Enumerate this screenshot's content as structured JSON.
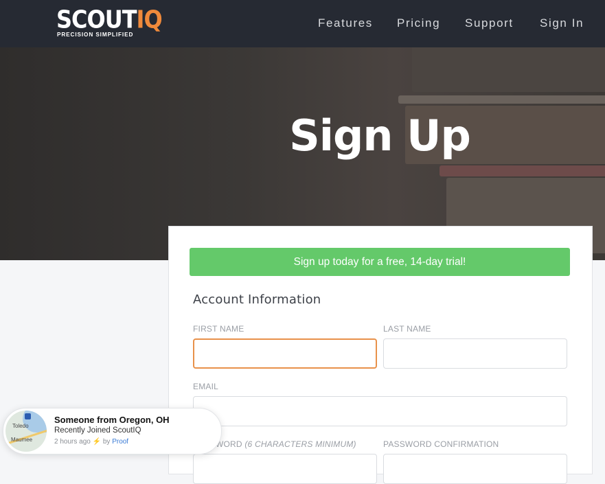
{
  "header": {
    "logo_main": "SCOUT",
    "logo_accent": "IQ",
    "logo_tagline": "PRECISION SIMPLIFIED",
    "nav": [
      {
        "label": "Features"
      },
      {
        "label": "Pricing"
      },
      {
        "label": "Support"
      },
      {
        "label": "Sign In"
      }
    ]
  },
  "hero": {
    "title": "Sign Up"
  },
  "form": {
    "banner": "Sign up today for a free, 14-day trial!",
    "section_title": "Account Information",
    "first_name_label": "FIRST NAME",
    "last_name_label": "LAST NAME",
    "email_label": "EMAIL",
    "password_label_partial": "WORD",
    "password_hint": "(6 CHARACTERS MINIMUM)",
    "password_confirm_label": "PASSWORD CONFIRMATION"
  },
  "notification": {
    "title": "Someone from Oregon, OH",
    "subtitle": "Recently Joined ScoutIQ",
    "time": "2 hours ago",
    "by": "by",
    "brand": "Proof",
    "map_city_1": "Toledo",
    "map_city_2": "Maumee"
  },
  "colors": {
    "header_bg": "#262a33",
    "accent_orange": "#f08a3b",
    "banner_green": "#64c96a",
    "focus_border": "#e8914a"
  }
}
